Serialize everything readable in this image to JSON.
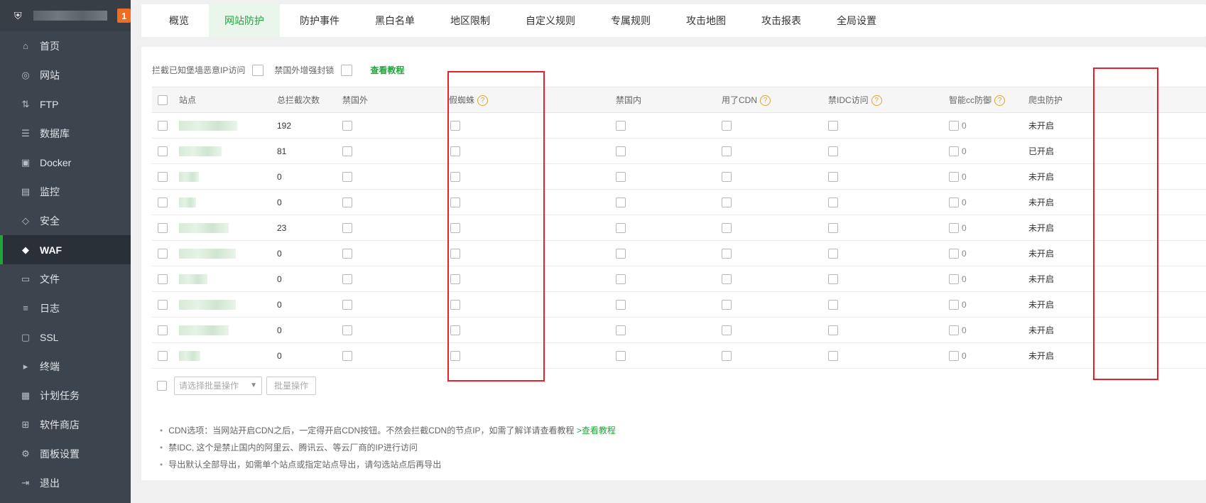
{
  "brand": {
    "badge": "1"
  },
  "sidebar": {
    "items": [
      {
        "label": "首页",
        "icon": "home-icon",
        "glyph": "⌂"
      },
      {
        "label": "网站",
        "icon": "globe-icon",
        "glyph": "◎"
      },
      {
        "label": "FTP",
        "icon": "ftp-icon",
        "glyph": "⇅"
      },
      {
        "label": "数据库",
        "icon": "database-icon",
        "glyph": "☰"
      },
      {
        "label": "Docker",
        "icon": "docker-icon",
        "glyph": "▣"
      },
      {
        "label": "监控",
        "icon": "monitor-icon",
        "glyph": "▤"
      },
      {
        "label": "安全",
        "icon": "shield-icon",
        "glyph": "◇"
      },
      {
        "label": "WAF",
        "icon": "waf-icon",
        "glyph": "◆"
      },
      {
        "label": "文件",
        "icon": "folder-icon",
        "glyph": "▭"
      },
      {
        "label": "日志",
        "icon": "log-icon",
        "glyph": "≡"
      },
      {
        "label": "SSL",
        "icon": "ssl-icon",
        "glyph": "▢"
      },
      {
        "label": "终端",
        "icon": "terminal-icon",
        "glyph": "▸"
      },
      {
        "label": "计划任务",
        "icon": "calendar-icon",
        "glyph": "▦"
      },
      {
        "label": "软件商店",
        "icon": "grid-icon",
        "glyph": "⊞"
      },
      {
        "label": "面板设置",
        "icon": "gear-icon",
        "glyph": "⚙"
      },
      {
        "label": "退出",
        "icon": "logout-icon",
        "glyph": "⇥"
      }
    ],
    "active_index": 7
  },
  "tabs": [
    "概览",
    "网站防护",
    "防护事件",
    "黑白名单",
    "地区限制",
    "自定义规则",
    "专属规则",
    "攻击地图",
    "攻击报表",
    "全局设置"
  ],
  "active_tab": 1,
  "options": {
    "block_known": "拦截已知堡墙恶意IP访问",
    "block_foreign": "禁国外增强封锁",
    "tutorial": "查看教程"
  },
  "table": {
    "headers": {
      "site": "站点",
      "total": "总拦截次数",
      "foreign": "禁国外",
      "fake_spider": "假蜘蛛",
      "domestic": "禁国内",
      "cdn": "用了CDN",
      "idc": "禁IDC访问",
      "cc": "智能cc防御",
      "crawler": "爬虫防护"
    },
    "rows": [
      {
        "total": "192",
        "cc": "0",
        "crawler": "未开启"
      },
      {
        "total": "81",
        "cc": "0",
        "crawler": "已开启"
      },
      {
        "total": "0",
        "cc": "0",
        "crawler": "未开启"
      },
      {
        "total": "0",
        "cc": "0",
        "crawler": "未开启"
      },
      {
        "total": "23",
        "cc": "0",
        "crawler": "未开启"
      },
      {
        "total": "0",
        "cc": "0",
        "crawler": "未开启"
      },
      {
        "total": "0",
        "cc": "0",
        "crawler": "未开启"
      },
      {
        "total": "0",
        "cc": "0",
        "crawler": "未开启"
      },
      {
        "total": "0",
        "cc": "0",
        "crawler": "未开启"
      },
      {
        "total": "0",
        "cc": "0",
        "crawler": "未开启"
      }
    ]
  },
  "batch": {
    "placeholder": "请选择批量操作",
    "button": "批量操作"
  },
  "notes": {
    "cdn": "CDN选项：当网站开启CDN之后，一定得开启CDN按钮。不然会拦截CDN的节点IP，如需了解详请查看教程",
    "cdn_link": ">查看教程",
    "idc": "禁IDC, 这个是禁止国内的阿里云、腾讯云、等云厂商的IP进行访问",
    "export": "导出默认全部导出，如需单个站点或指定站点导出，请勾选站点后再导出"
  },
  "colors": {
    "accent": "#20a53a",
    "count_red": "#e81e1e",
    "status_off": "#d4880b",
    "highlight": "#e8202a"
  }
}
